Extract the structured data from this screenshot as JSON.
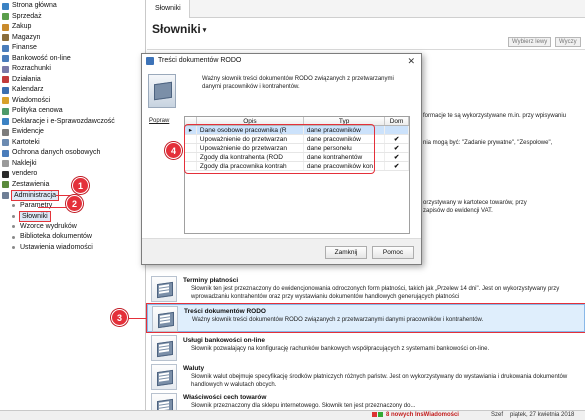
{
  "sidebar": {
    "items": [
      {
        "label": "Strona główna",
        "color": "#3b82c4"
      },
      {
        "label": "Sprzedaż",
        "color": "#5a9e4b"
      },
      {
        "label": "Zakup",
        "color": "#c98a2b"
      },
      {
        "label": "Magazyn",
        "color": "#8a6d3b"
      },
      {
        "label": "Finanse",
        "color": "#4a7dbb"
      },
      {
        "label": "Bankowość on-line",
        "color": "#4a7dbb"
      },
      {
        "label": "Rozrachunki",
        "color": "#7a7aa8"
      },
      {
        "label": "Działania",
        "color": "#c23b3b"
      },
      {
        "label": "Kalendarz",
        "color": "#3b6fb0"
      },
      {
        "label": "Wiadomości",
        "color": "#d8a12b"
      },
      {
        "label": "Polityka cenowa",
        "color": "#4d9a6b"
      },
      {
        "label": "Deklaracje i e-Sprawozdawczość",
        "color": "#3b82c4"
      },
      {
        "label": "Ewidencje",
        "color": "#7d7d7d"
      },
      {
        "label": "Kartoteki",
        "color": "#6c8bb1"
      },
      {
        "label": "Ochrona danych osobowych",
        "color": "#4a7dbb"
      },
      {
        "label": "Naklejki",
        "color": "#9a9a9a"
      },
      {
        "label": "vendero",
        "color": "#2b2b2b"
      },
      {
        "label": "Zestawienia",
        "color": "#5a8a3c"
      },
      {
        "label": "Administracja",
        "color": "#6f7f96"
      }
    ],
    "subitems": [
      "Parametry",
      "Słowniki",
      "Wzorce wydruków",
      "Biblioteka dokumentów",
      "Ustawienia wiadomości"
    ]
  },
  "callouts": [
    "1",
    "2",
    "3",
    "4"
  ],
  "main": {
    "tab": "Słowniki",
    "title": "Słowniki",
    "toolbar": {
      "btn1": "Wybierz lewy",
      "btn2": "Wyczy"
    },
    "fragments": [
      "formacje te są wykorzystywane m.in. przy wpisywaniu",
      "nia mogą być: \"Zadanie prywatne\", \"Zespołowe\",",
      "orzystywany w kartotece towarów, przy",
      "zapisów do ewidencji VAT."
    ],
    "entries": [
      {
        "title": "Terminy płatności",
        "desc": "Słownik ten jest przeznaczony do ewidencjonowania odroczonych form płatności, takich jak „Przelew 14 dni\". Jest on wykorzystywany przy wprowadzaniu kontrahentów oraz przy wystawianiu dokumentów handlowych generujących płatności"
      },
      {
        "title": "Treści dokumentów RODO",
        "desc": "Ważny słownik treści dokumentów RODO związanych z przetwarzanymi danymi pracowników i kontrahentów."
      },
      {
        "title": "Usługi bankowości on-line",
        "desc": "Słownik pozwalający na konfigurację rachunków bankowych współpracujących z systemami bankowości on-line."
      },
      {
        "title": "Waluty",
        "desc": "Słownik walut obejmuje specyfikację środków płatniczych różnych państw. Jest on wykorzystywany do wystawiania i drukowania dokumentów handlowych w walutach obcych."
      },
      {
        "title": "Właściwości cech towarów",
        "desc": "Słownik przeznaczony dla sklepu internetowego. Słownik ten jest przeznaczony do..."
      }
    ]
  },
  "dialog": {
    "title": "Treści dokumentów RODO",
    "description": "Ważny słownik treści dokumentów RODO związanych z przetwarzanymi danymi pracowników i kontrahentów.",
    "link": "Popraw",
    "columns": [
      "Opis",
      "Typ",
      "Dom"
    ],
    "rows": [
      {
        "opis": "Dane osobowe pracownika (R",
        "typ": "dane pracowników",
        "dom": ""
      },
      {
        "opis": "Upoważnienie do przetwarzan",
        "typ": "dane pracowników",
        "dom": "✔"
      },
      {
        "opis": "Upoważnienie do przetwarzan",
        "typ": "dane personelu",
        "dom": "✔"
      },
      {
        "opis": "Zgody dla kontrahenta (ROD",
        "typ": "dane kontrahentów",
        "dom": "✔"
      },
      {
        "opis": "Zgody dla pracownika kontrah",
        "typ": "dane pracowników kon",
        "dom": "✔"
      }
    ],
    "ok_label": "Zamknij",
    "help_label": "Pomoc"
  },
  "statusbar": {
    "messages": "8 nowych InsWiadomości",
    "user": "Szef",
    "date": "piątek, 27 kwietnia 2018"
  },
  "colors": {
    "accent": "#e4303a",
    "selection": "#cce2fb",
    "highlight": "#dfeefc"
  }
}
